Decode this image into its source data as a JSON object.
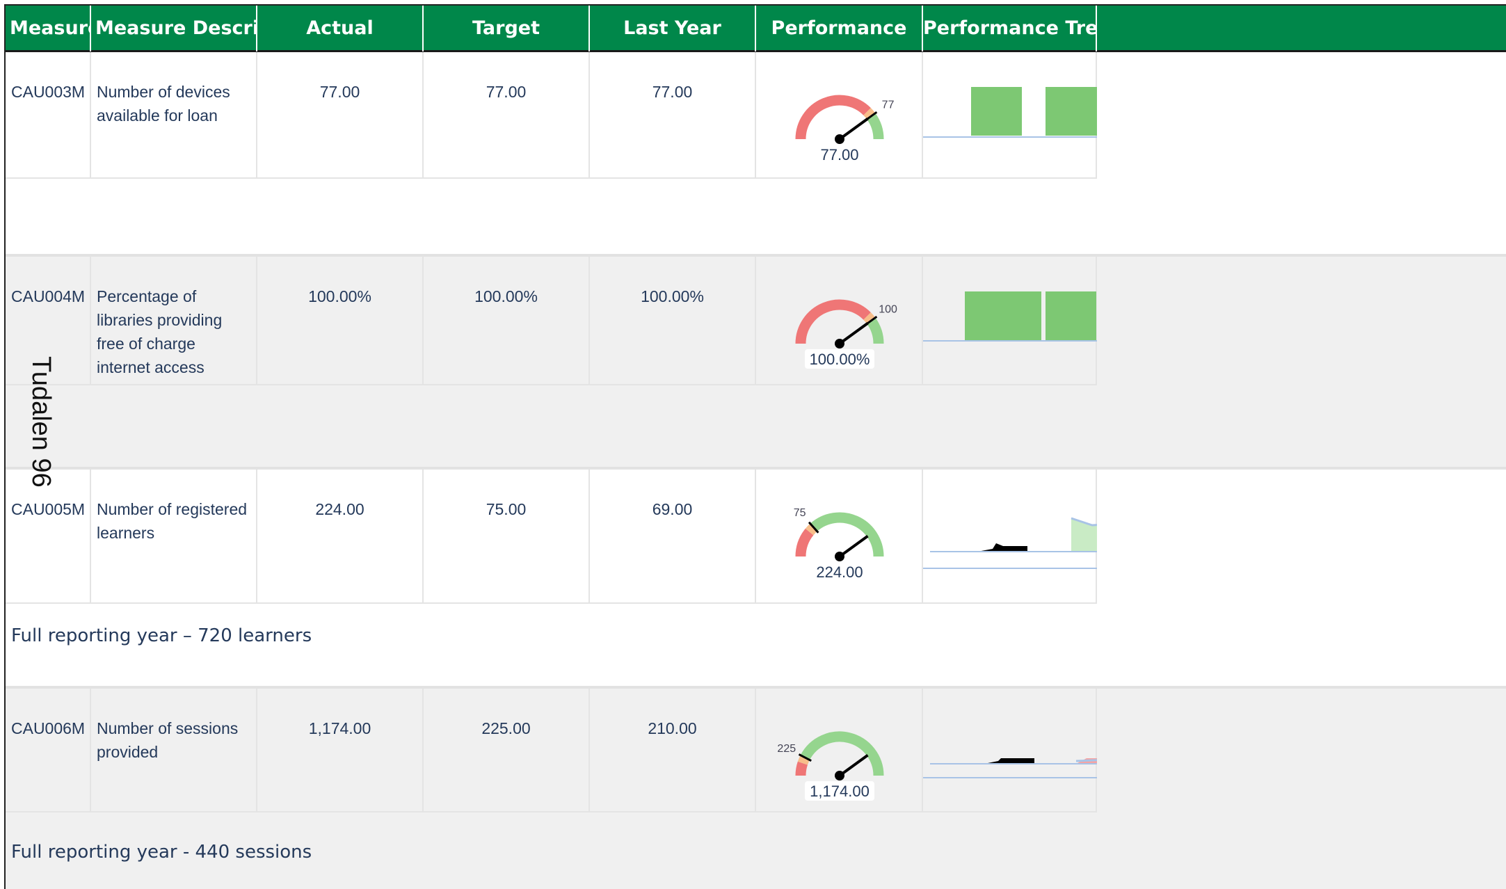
{
  "headers": {
    "measure": "Measure",
    "description": "Measure Description",
    "actual": "Actual",
    "target": "Target",
    "last_year": "Last Year",
    "performance": "Performance",
    "trend": "Performance Trend"
  },
  "rows": [
    {
      "measure": "CAU003M",
      "description": "Number of devices available for loan",
      "actual": "77.00",
      "target": "77.00",
      "last_year": "77.00",
      "gauge": {
        "value": 77,
        "target": 77,
        "target_label": "77",
        "value_label": "77.00"
      },
      "comment": ""
    },
    {
      "measure": "CAU004M",
      "description": "Percentage of libraries providing free of charge internet access",
      "actual": "100.00%",
      "target": "100.00%",
      "last_year": "100.00%",
      "gauge": {
        "value": 100,
        "target": 100,
        "target_label": "100",
        "value_label": "100.00%"
      },
      "comment": ""
    },
    {
      "measure": "CAU005M",
      "description": "Number of registered learners",
      "actual": "224.00",
      "target": "75.00",
      "last_year": "69.00",
      "gauge": {
        "value": 224,
        "target": 75,
        "target_label": "75",
        "value_label": "224.00"
      },
      "comment": "Full reporting year – 720 learners"
    },
    {
      "measure": "CAU006M",
      "description": "Number of sessions provided",
      "actual": "1,174.00",
      "target": "225.00",
      "last_year": "210.00",
      "gauge": {
        "value": 1174,
        "target": 225,
        "target_label": "225",
        "value_label": "1,174.00"
      },
      "comment": "Full reporting year - 440 sessions"
    }
  ],
  "page_label": "Tudalen 96",
  "colors": {
    "header_bg": "#00874a",
    "gauge_red": "#ef7676",
    "gauge_amber": "#f7be8a",
    "gauge_green": "#95d58e",
    "trend_green": "#7dc873",
    "trend_area_green": "#c9ebc5",
    "trend_line": "#a8c3e6",
    "trend_red": "#f5a3a3"
  }
}
